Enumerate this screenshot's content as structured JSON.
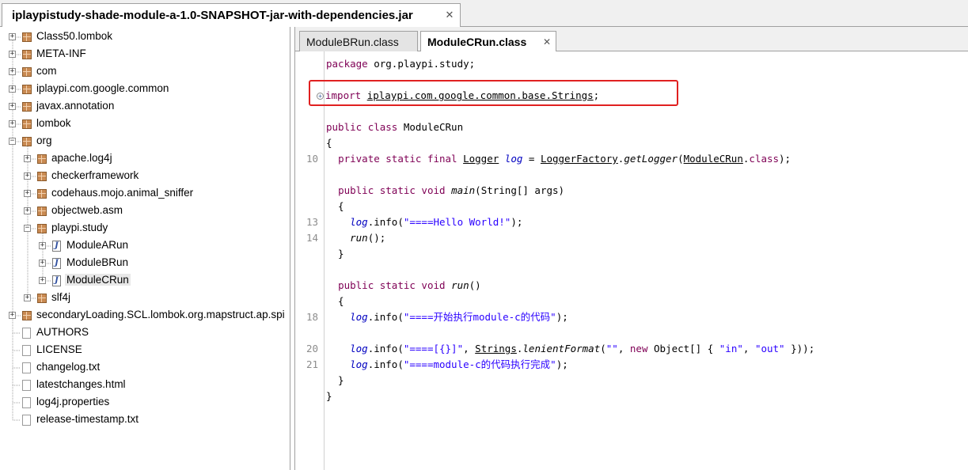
{
  "jar_tab": {
    "title": "iplaypistudy-shade-module-a-1.0-SNAPSHOT-jar-with-dependencies.jar",
    "close": "✕"
  },
  "tree": {
    "items": [
      {
        "label": "Class50.lombok",
        "kind": "package",
        "depth": 0,
        "toggle": "+"
      },
      {
        "label": "META-INF",
        "kind": "package",
        "depth": 0,
        "toggle": "+"
      },
      {
        "label": "com",
        "kind": "package",
        "depth": 0,
        "toggle": "+"
      },
      {
        "label": "iplaypi.com.google.common",
        "kind": "package",
        "depth": 0,
        "toggle": "+"
      },
      {
        "label": "javax.annotation",
        "kind": "package",
        "depth": 0,
        "toggle": "+"
      },
      {
        "label": "lombok",
        "kind": "package",
        "depth": 0,
        "toggle": "+"
      },
      {
        "label": "org",
        "kind": "package",
        "depth": 0,
        "toggle": "−"
      },
      {
        "label": "apache.log4j",
        "kind": "package",
        "depth": 1,
        "toggle": "+"
      },
      {
        "label": "checkerframework",
        "kind": "package",
        "depth": 1,
        "toggle": "+"
      },
      {
        "label": "codehaus.mojo.animal_sniffer",
        "kind": "package",
        "depth": 1,
        "toggle": "+"
      },
      {
        "label": "objectweb.asm",
        "kind": "package",
        "depth": 1,
        "toggle": "+"
      },
      {
        "label": "playpi.study",
        "kind": "package",
        "depth": 1,
        "toggle": "−"
      },
      {
        "label": "ModuleARun",
        "kind": "java",
        "depth": 2,
        "toggle": "+"
      },
      {
        "label": "ModuleBRun",
        "kind": "java",
        "depth": 2,
        "toggle": "+"
      },
      {
        "label": "ModuleCRun",
        "kind": "java",
        "depth": 2,
        "toggle": "+",
        "selected": true
      },
      {
        "label": "slf4j",
        "kind": "package",
        "depth": 1,
        "toggle": "+"
      },
      {
        "label": "secondaryLoading.SCL.lombok.org.mapstruct.ap.spi",
        "kind": "package",
        "depth": 0,
        "toggle": "+"
      },
      {
        "label": "AUTHORS",
        "kind": "file",
        "depth": 0
      },
      {
        "label": "LICENSE",
        "kind": "file",
        "depth": 0
      },
      {
        "label": "changelog.txt",
        "kind": "file",
        "depth": 0
      },
      {
        "label": "latestchanges.html",
        "kind": "file",
        "depth": 0
      },
      {
        "label": "log4j.properties",
        "kind": "file",
        "depth": 0
      },
      {
        "label": "release-timestamp.txt",
        "kind": "file",
        "depth": 0
      }
    ]
  },
  "editor": {
    "tabs": [
      {
        "label": "ModuleBRun.class",
        "active": false
      },
      {
        "label": "ModuleCRun.class",
        "active": true,
        "close": "✕"
      }
    ],
    "line_numbers": [
      {
        "n": "10",
        "row": 6
      },
      {
        "n": "13",
        "row": 10
      },
      {
        "n": "14",
        "row": 11
      },
      {
        "n": "18",
        "row": 16
      },
      {
        "n": "20",
        "row": 18
      },
      {
        "n": "21",
        "row": 19
      }
    ],
    "code": {
      "l0": {
        "kw": "package",
        "rest": " org.playpi.study;"
      },
      "l2": {
        "kw": "import",
        "sp": " ",
        "path": "iplaypi.com.google.common.base.Strings",
        "semi": ";",
        "fold": "+"
      },
      "l4": {
        "kw1": "public",
        "kw2": "class",
        "name": " ModuleCRun"
      },
      "l5": "{",
      "l6": {
        "indent": "  ",
        "kw": "private static final",
        "type": "Logger",
        "field": "log",
        "eq": " = ",
        "factory": "LoggerFactory",
        "dot": ".",
        "method": "getLogger",
        "open": "(",
        "cls": "ModuleCRun",
        "dotclass": ".",
        "classkw": "class",
        "close": ");"
      },
      "l8": {
        "indent": "  ",
        "kw": "public static void",
        "method": "main",
        "args": "(String[] args)"
      },
      "l9": "  {",
      "l10": {
        "indent": "    ",
        "field": "log",
        "call": ".info(",
        "str": "\"====Hello World!\"",
        "end": ");"
      },
      "l11": {
        "indent": "    ",
        "method": "run",
        "end": "();"
      },
      "l12": "  }",
      "l14": {
        "indent": "  ",
        "kw": "public static void",
        "method": "run",
        "args": "()"
      },
      "l15": "  {",
      "l16": {
        "indent": "    ",
        "field": "log",
        "call": ".info(",
        "str": "\"====开始执行module-c的代码\"",
        "end": ");"
      },
      "l18": {
        "indent": "    ",
        "field": "log",
        "call": ".info(",
        "str1": "\"====[{}]\"",
        "comma1": ", ",
        "cls": "Strings",
        "dot": ".",
        "method": "lenientFormat",
        "open": "(",
        "str2": "\"\"",
        "comma2": ", ",
        "newkw": "new",
        "obj": " Object[] { ",
        "str3": "\"in\"",
        "comma3": ", ",
        "str4": "\"out\"",
        "end": " }));"
      },
      "l19": {
        "indent": "    ",
        "field": "log",
        "call": ".info(",
        "str": "\"====module-c的代码执行完成\"",
        "end": ");"
      },
      "l20": "  }",
      "l21": "}"
    }
  },
  "colors": {
    "keyword": "#7f0055",
    "string": "#2a00ff",
    "field": "#0000c0",
    "highlight_box": "#e02020"
  }
}
